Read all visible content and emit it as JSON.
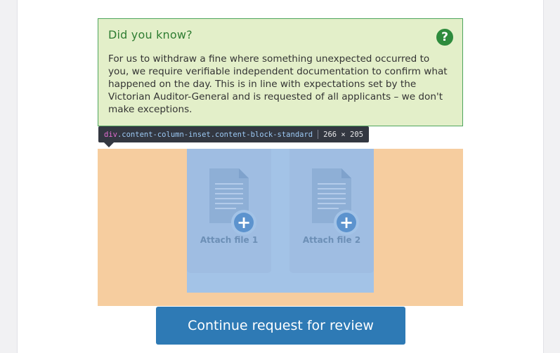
{
  "info_box": {
    "title": "Did you know?",
    "help_icon_glyph": "?",
    "body": "For us to withdraw a fine where something unexpected occurred to you, we require verifiable independent documentation to confirm what happened on the day. This is in line with expectations set by the Victorian Auditor-General and is requested of all applicants – we don't make exceptions.",
    "colors": {
      "background": "#e3efc9",
      "border": "#4fa55d",
      "title": "#2f7d32"
    }
  },
  "devtools_tooltip": {
    "tag": "div",
    "classes": ".content-column-inset.content-block-standard",
    "size": "266 × 205"
  },
  "uploads": [
    {
      "label": "Attach file 1",
      "icon": "document-add-icon"
    },
    {
      "label": "Attach file 2",
      "icon": "document-add-icon"
    }
  ],
  "continue_button": {
    "label": "Continue request for review",
    "color": "#2e7ab5"
  }
}
